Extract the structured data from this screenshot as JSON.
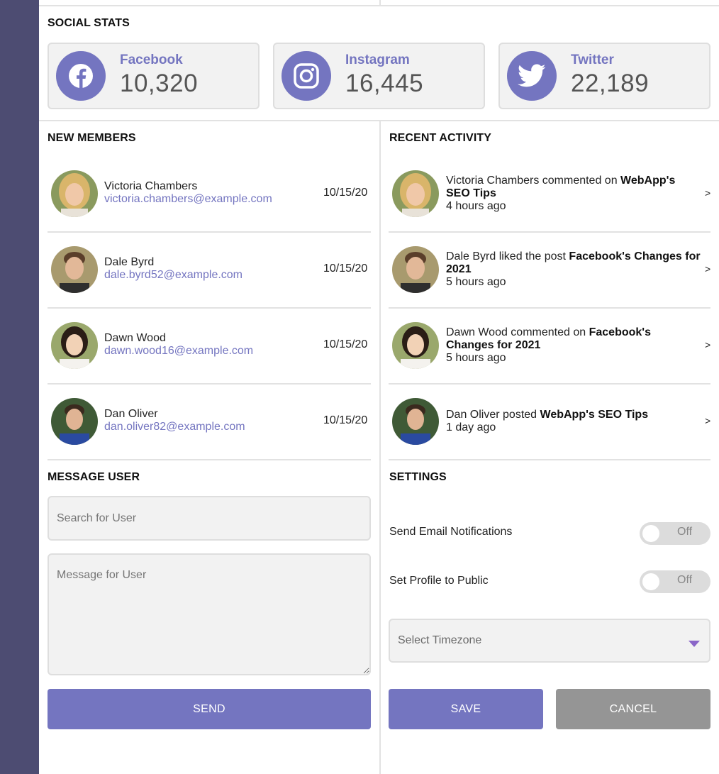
{
  "social": {
    "title": "SOCIAL STATS",
    "cards": [
      {
        "name": "Facebook",
        "value": "10,320",
        "icon": "facebook-icon"
      },
      {
        "name": "Instagram",
        "value": "16,445",
        "icon": "instagram-icon"
      },
      {
        "name": "Twitter",
        "value": "22,189",
        "icon": "twitter-icon"
      }
    ]
  },
  "members": {
    "title": "NEW MEMBERS",
    "items": [
      {
        "name": "Victoria Chambers",
        "email": "victoria.chambers@example.com",
        "date": "10/15/20"
      },
      {
        "name": "Dale Byrd",
        "email": "dale.byrd52@example.com",
        "date": "10/15/20"
      },
      {
        "name": "Dawn Wood",
        "email": "dawn.wood16@example.com",
        "date": "10/15/20"
      },
      {
        "name": "Dan Oliver",
        "email": "dan.oliver82@example.com",
        "date": "10/15/20"
      }
    ]
  },
  "activity": {
    "title": "RECENT ACTIVITY",
    "items": [
      {
        "text": "Victoria Chambers commented on ",
        "target": "WebApp's SEO Tips",
        "time": "4 hours ago",
        "arrow": ">"
      },
      {
        "text": "Dale Byrd liked the post ",
        "target": "Facebook's Changes for 2021",
        "time": "5 hours ago",
        "arrow": ">"
      },
      {
        "text": "Dawn Wood commented on ",
        "target": "Facebook's Changes for 2021",
        "time": "5 hours ago",
        "arrow": ">"
      },
      {
        "text": "Dan Oliver posted ",
        "target": "WebApp's SEO Tips",
        "time": "1 day ago",
        "arrow": ">"
      }
    ]
  },
  "message": {
    "title": "MESSAGE USER",
    "search_placeholder": "Search for User",
    "message_placeholder": "Message for User",
    "send_label": "SEND"
  },
  "settings": {
    "title": "SETTINGS",
    "email_label": "Send Email Notifications",
    "email_state": "Off",
    "public_label": "Set Profile to Public",
    "public_state": "Off",
    "timezone_placeholder": "Select Timezone",
    "save_label": "SAVE",
    "cancel_label": "CANCEL"
  },
  "colors": {
    "accent": "#7475c0",
    "sidebar": "#4d4c72",
    "cancel": "#959595"
  }
}
